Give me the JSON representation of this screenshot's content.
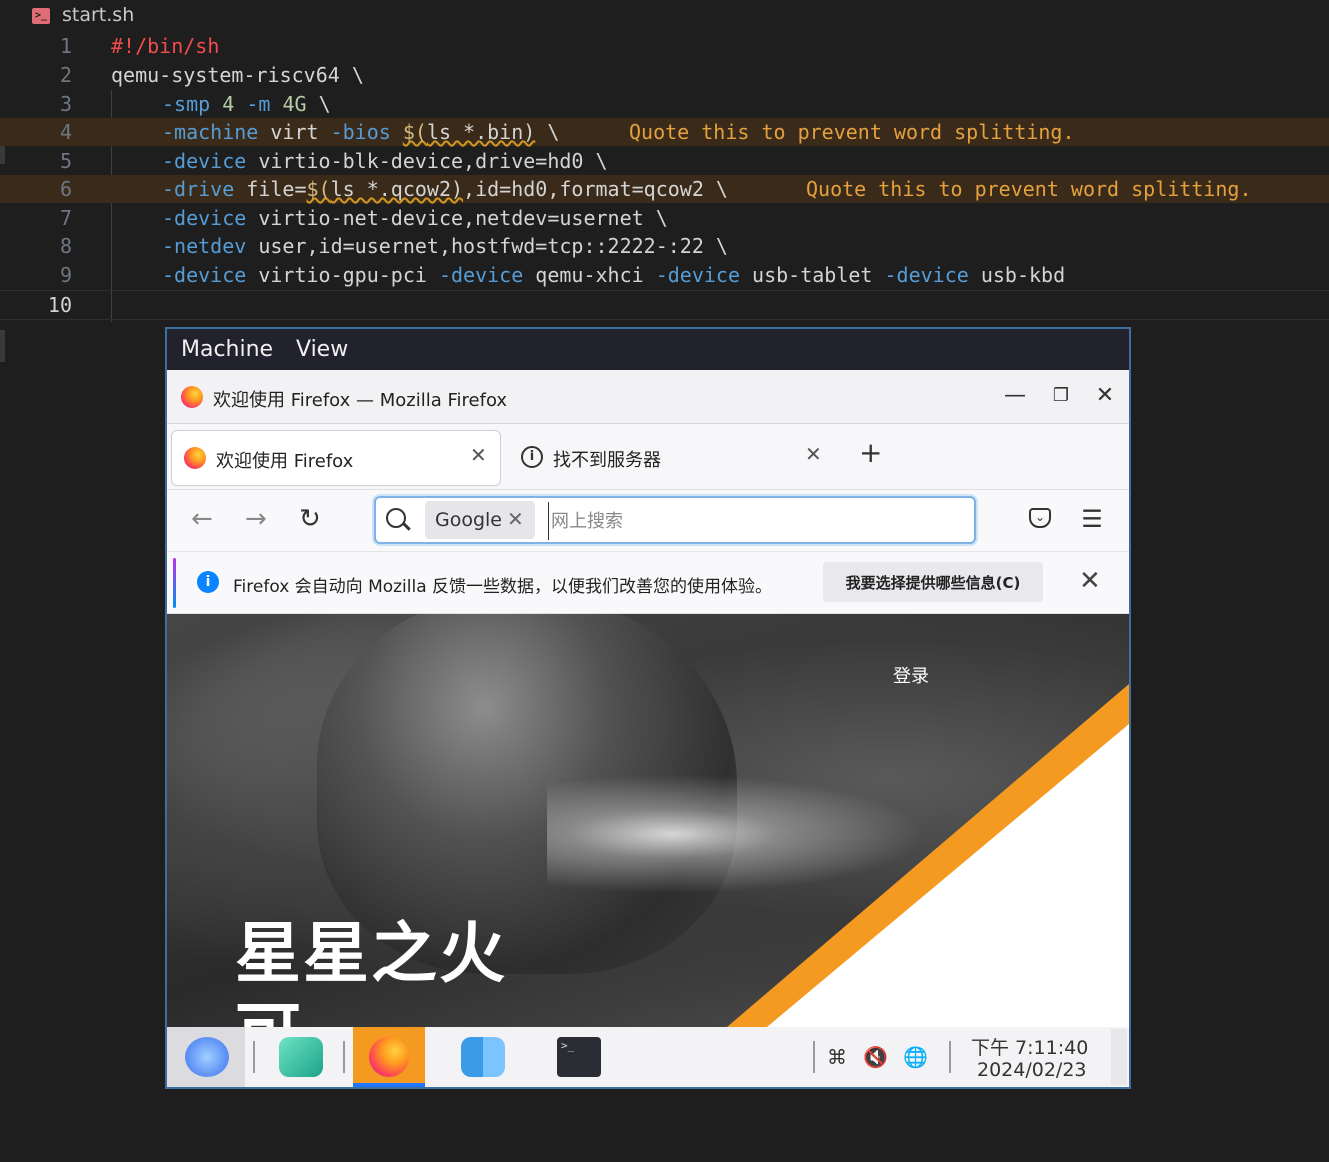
{
  "editor": {
    "file_name": "start.sh",
    "lines": [
      {
        "n": "1"
      },
      {
        "n": "2"
      },
      {
        "n": "3"
      },
      {
        "n": "4"
      },
      {
        "n": "5"
      },
      {
        "n": "6"
      },
      {
        "n": "7"
      },
      {
        "n": "8"
      },
      {
        "n": "9"
      },
      {
        "n": "10"
      }
    ],
    "code": {
      "l1": "#!/bin/sh",
      "l2": "qemu-system-riscv64 \\",
      "l3_flag1": "-smp",
      "l3_num1": "4",
      "l3_flag2": "-m",
      "l3_num2": "4G",
      "l3_tail": " \\",
      "l4_flag1": "-machine",
      "l4_arg1": " virt ",
      "l4_flag2": "-bios",
      "l4_dollar": "$(",
      "l4_sub": "ls *.bin)",
      "l4_tail": " \\",
      "l5_flag": "-device",
      "l5_arg": " virtio-blk-device,drive=hd0 \\",
      "l6_flag": "-drive",
      "l6_arg1": " file=",
      "l6_dollar": "$(",
      "l6_sub": "ls *.qcow2)",
      "l6_arg2": ",id=hd0,format=qcow2 \\",
      "l7_flag": "-device",
      "l7_arg": " virtio-net-device,netdev=usernet \\",
      "l8_flag": "-netdev",
      "l8_arg": " user,id=usernet,hostfwd=tcp::2222-:22 \\",
      "l9_flag1": "-device",
      "l9_arg1": " virtio-gpu-pci ",
      "l9_flag2": "-device",
      "l9_arg2": " qemu-xhci ",
      "l9_flag3": "-device",
      "l9_arg3": " usb-tablet ",
      "l9_flag4": "-device",
      "l9_arg4": " usb-kbd"
    },
    "diagnostics": {
      "line4": "Quote this to prevent word splitting.",
      "line6": "Quote this to prevent word splitting."
    }
  },
  "vm": {
    "menu": [
      "Machine",
      "View"
    ],
    "firefox": {
      "window_title": "欢迎使用 Firefox — Mozilla Firefox",
      "window_buttons": {
        "minimize": "—",
        "restore": "❐",
        "close": "✕"
      },
      "tabs": [
        {
          "label": "欢迎使用 Firefox",
          "close": "✕"
        },
        {
          "label": "找不到服务器",
          "close": "✕",
          "icon": "i"
        }
      ],
      "new_tab": "+",
      "nav": {
        "back": "←",
        "forward": "→",
        "reload": "↻"
      },
      "search": {
        "engine": "Google",
        "engine_remove": "✕",
        "placeholder": "网上搜索"
      },
      "menu_icon": "☰",
      "notice": {
        "text": "Firefox 会自动向 Mozilla 反馈一些数据，以便我们改善您的使用体验。",
        "button": "我要选择提供哪些信息(C)",
        "close": "✕",
        "info": "i"
      },
      "hero": {
        "login": "登录",
        "title": "星星之火可"
      }
    },
    "taskbar": {
      "tray": {
        "keyboard": "⌘",
        "mute": "🔇",
        "network": "🌐"
      },
      "clock_time": "下午 7:11:40",
      "clock_date": "2024/02/23"
    },
    "colors": {
      "accent": "#f59a20",
      "link": "#0a84ff",
      "vm_border": "#3c6ea0"
    }
  }
}
